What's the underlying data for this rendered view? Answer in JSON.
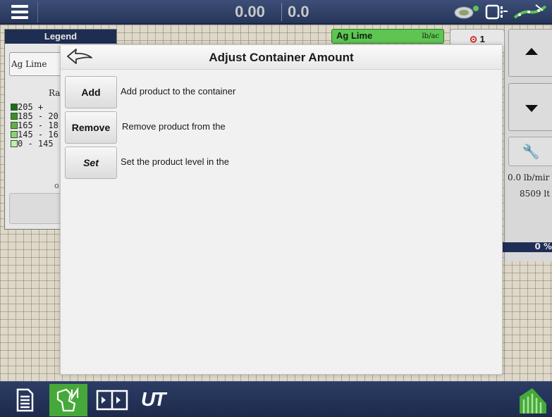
{
  "topbar": {
    "speed": "0.00",
    "heading": "0.0",
    "icons": [
      "menu-icon",
      "product-blend-icon",
      "implement-icon",
      "gps-signal-icon"
    ]
  },
  "legend": {
    "tab_label": "Legend",
    "product": "Ag Lime",
    "rate_label": "Ra",
    "ranges": [
      {
        "label": "205 +",
        "color": "#1f6b1a"
      },
      {
        "label": "185 - 20",
        "color": "#3e8e2e"
      },
      {
        "label": "165 - 18",
        "color": "#62b04a"
      },
      {
        "label": "145 - 16",
        "color": "#8fd07a"
      },
      {
        "label": "0 - 145",
        "color": "#c6ebb8"
      }
    ],
    "extra_char": "o"
  },
  "rate": {
    "product": "Ag Lime",
    "unit": "lb/ac",
    "alarm_count": "1",
    "flow": "0.0 lb/mir",
    "weight": "8509 lt",
    "fill_pct": "0 %"
  },
  "dialog": {
    "title": "Adjust Container Amount",
    "options": [
      {
        "label": "Add",
        "desc": "Add product to the container"
      },
      {
        "label": "Remove",
        "desc": "Remove product from the"
      },
      {
        "label": "Set",
        "desc": "Set the product level in the"
      }
    ]
  },
  "bottombar": {
    "items": [
      "document-icon",
      "field-map-icon",
      "split-view-icon",
      "ut-icon",
      "field-operations-icon"
    ],
    "ut_label": "UT"
  },
  "colors": {
    "accent_green": "#46a83a",
    "rate_header_green": "#5ec452",
    "navy": "#1e2d52",
    "alarm_red": "#cc0000"
  }
}
